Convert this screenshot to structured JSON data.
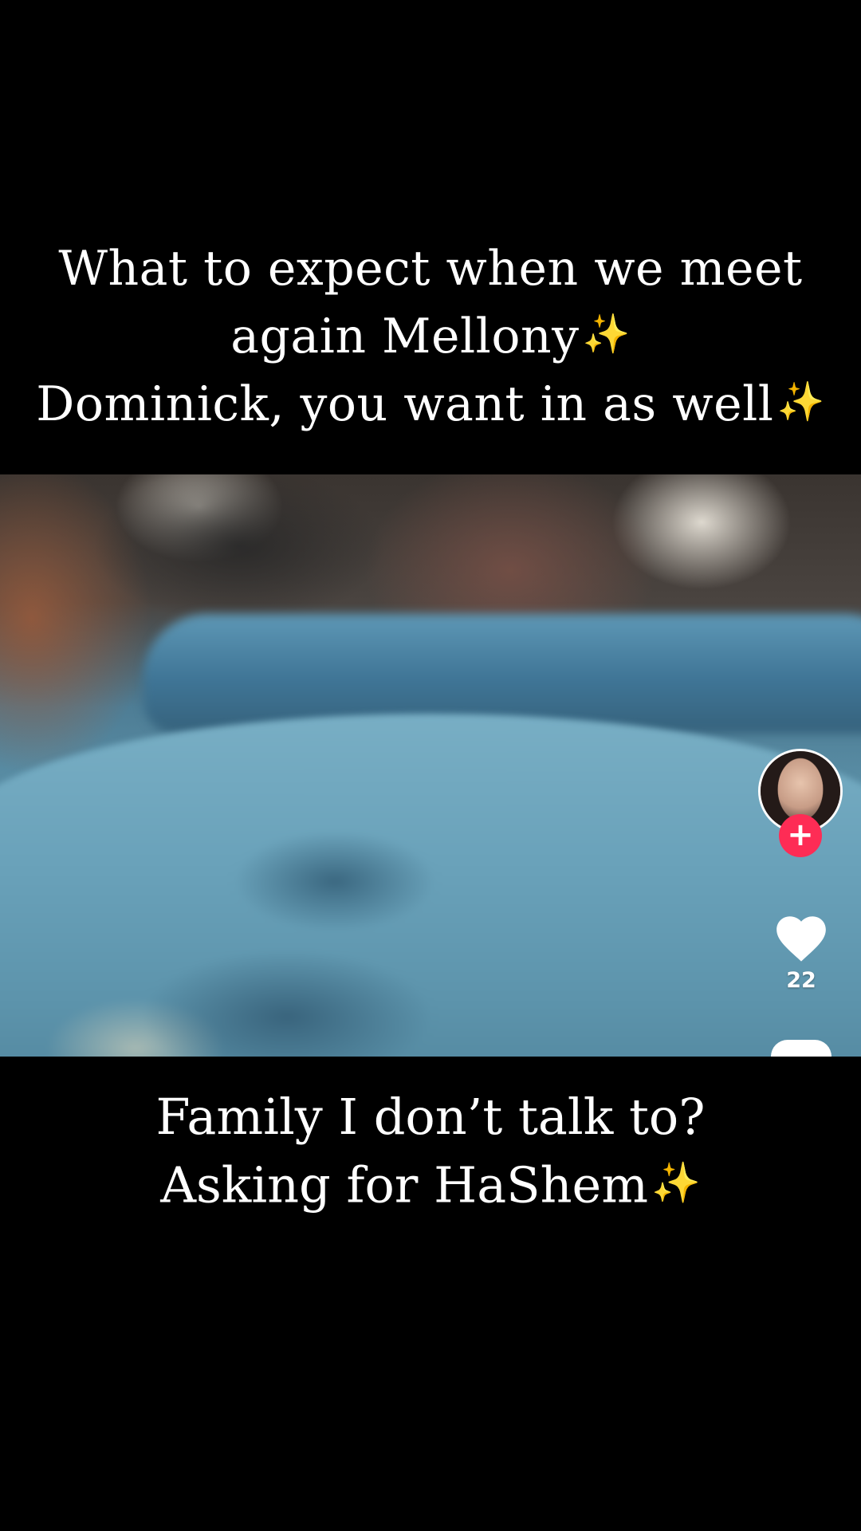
{
  "caption_top": {
    "line1": "What to expect when we meet",
    "line2": "again Mellony",
    "line3": "Dominick, you want in as well",
    "sparkle": "✨"
  },
  "caption_bottom": {
    "line1": "Family I don’t talk to?",
    "line2": "Asking for HaShem",
    "sparkle": "✨"
  },
  "sidebar": {
    "follow_symbol": "+",
    "like_count": "22"
  },
  "colors": {
    "background": "#000000",
    "text": "#ffffff",
    "follow_badge": "#fe2c55",
    "sparkle": "#f5c842"
  },
  "icons": {
    "like": "heart-icon",
    "follow": "plus-icon"
  }
}
